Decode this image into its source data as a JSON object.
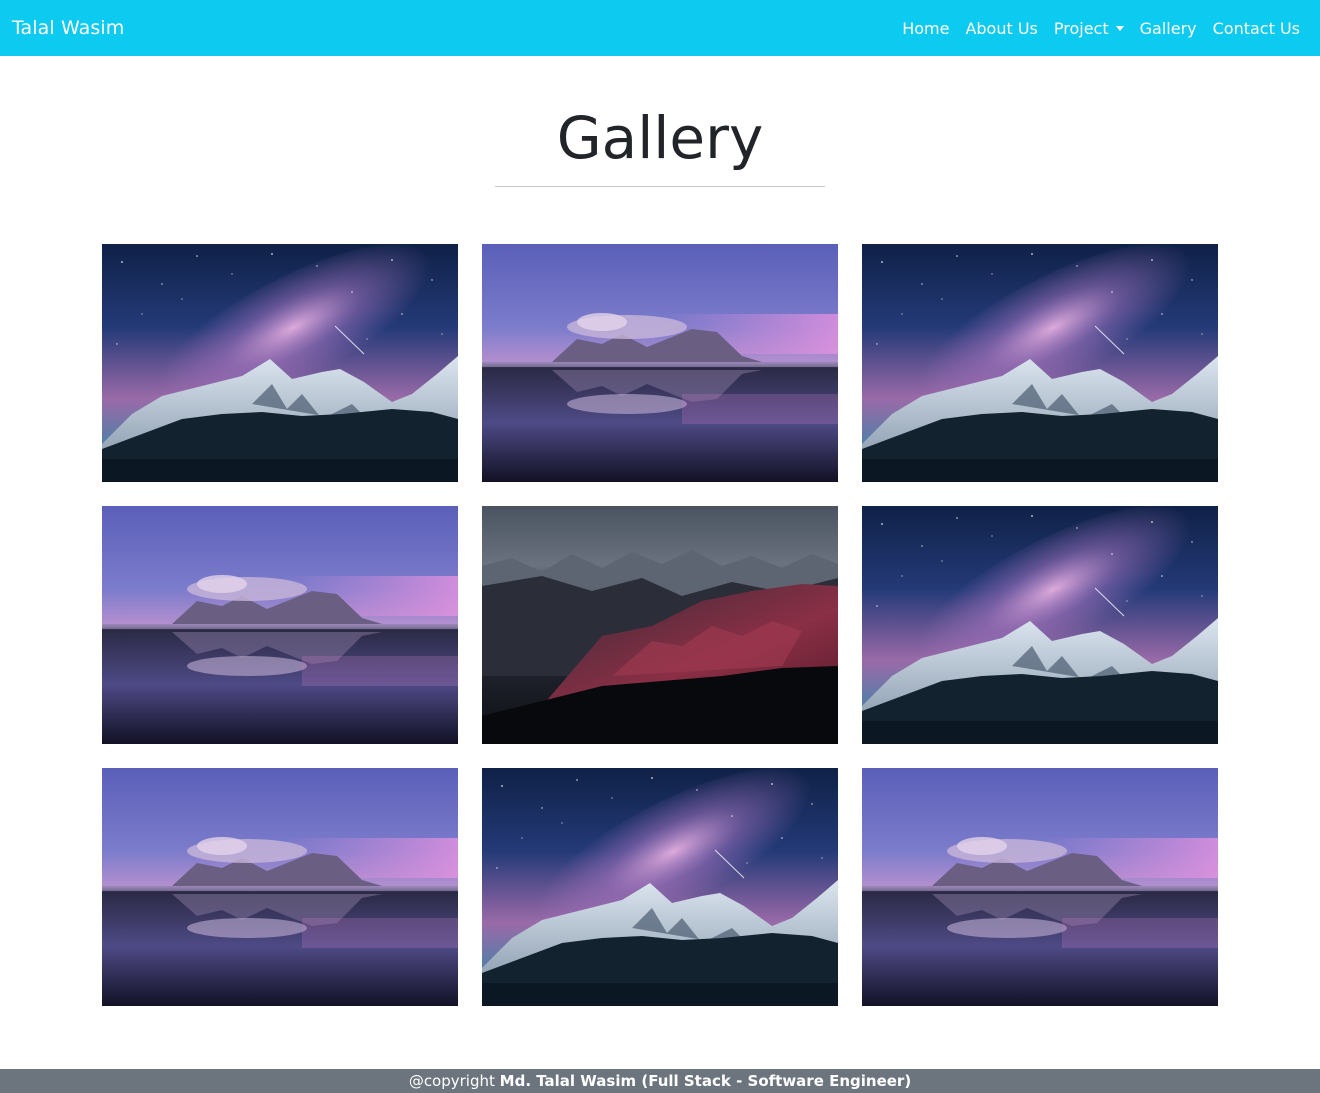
{
  "navbar": {
    "brand": "Talal Wasim",
    "background": "#0dcaf0",
    "items": [
      {
        "label": "Home"
      },
      {
        "label": "About Us"
      },
      {
        "label": "Project",
        "dropdown": true
      },
      {
        "label": "Gallery"
      },
      {
        "label": "Contact Us"
      }
    ]
  },
  "main": {
    "title": "Gallery"
  },
  "gallery": {
    "images": [
      {
        "scene": "milky-way-mountains"
      },
      {
        "scene": "mountain-lake-reflection"
      },
      {
        "scene": "milky-way-mountains"
      },
      {
        "scene": "mountain-lake-reflection"
      },
      {
        "scene": "red-mountain-range"
      },
      {
        "scene": "milky-way-mountains"
      },
      {
        "scene": "mountain-lake-reflection"
      },
      {
        "scene": "milky-way-mountains"
      },
      {
        "scene": "mountain-lake-reflection"
      }
    ]
  },
  "footer": {
    "prefix": "@copyright ",
    "author": "Md. Talal Wasim (Full Stack - Software Engineer)",
    "background": "#6c757d"
  }
}
